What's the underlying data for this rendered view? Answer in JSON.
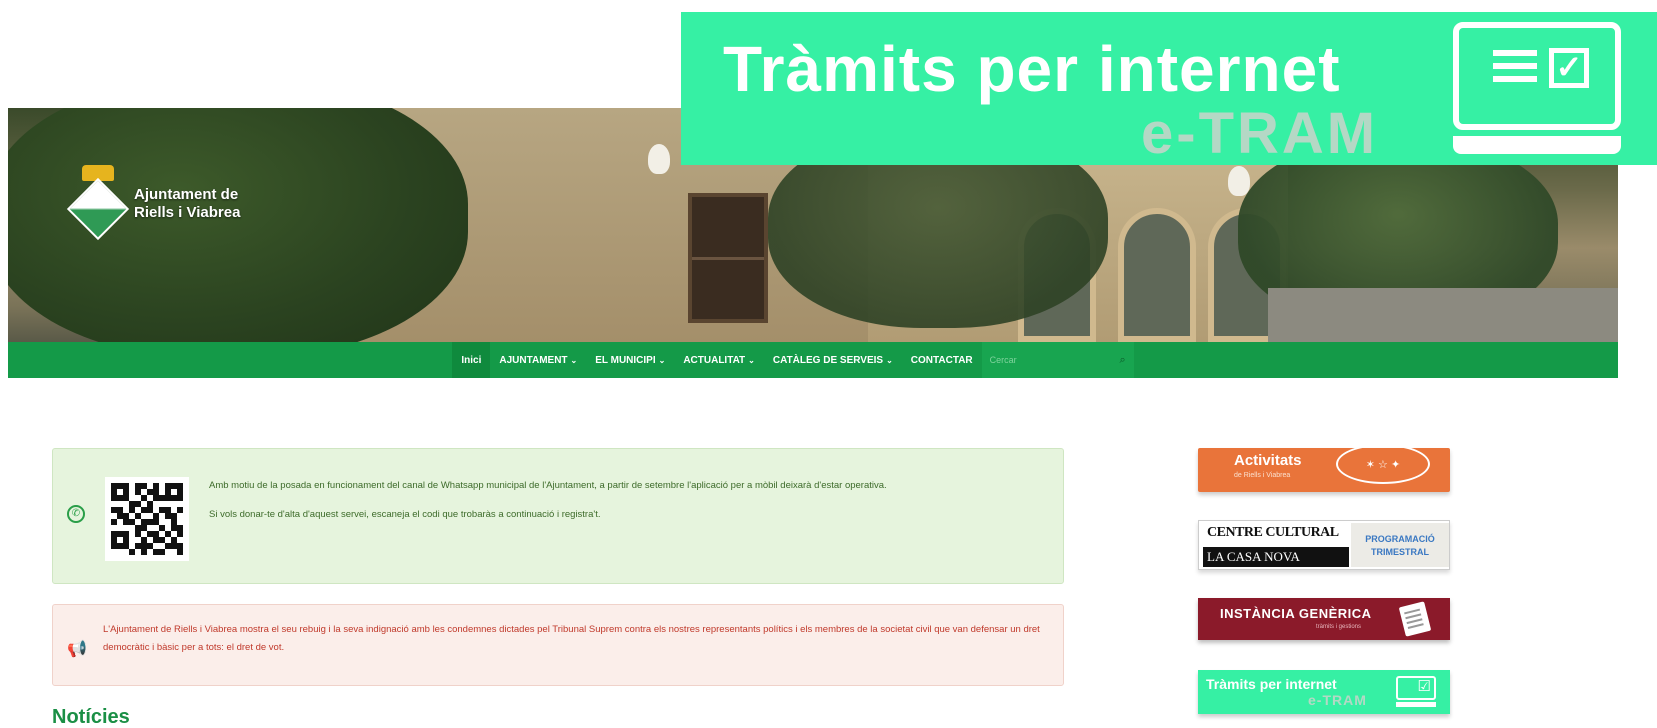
{
  "header": {
    "logo_line1": "Ajuntament de",
    "logo_line2": "Riells i Viabrea"
  },
  "etram_banner": {
    "title": "Tràmits per internet",
    "subtitle": "e-TRAM"
  },
  "nav": {
    "items": [
      {
        "label": "Inici",
        "active": true,
        "has_dropdown": false
      },
      {
        "label": "AJUNTAMENT",
        "has_dropdown": true
      },
      {
        "label": "EL MUNICIPI",
        "has_dropdown": true
      },
      {
        "label": "ACTUALITAT",
        "has_dropdown": true
      },
      {
        "label": "CATÀLEG DE SERVEIS",
        "has_dropdown": true
      },
      {
        "label": "CONTACTAR",
        "has_dropdown": false
      }
    ],
    "search_placeholder": "Cercar"
  },
  "alerts": {
    "whatsapp_p1": "Amb motiu de la posada en funcionament del canal de Whatsapp municipal de l'Ajuntament, a partir de setembre l'aplicació per a mòbil deixarà d'estar operativa.",
    "whatsapp_p2": "Si vols donar-te d'alta d'aquest servei, escaneja el codi que trobaràs a continuació i registra't.",
    "notice": "L'Ajuntament de Riells i Viabrea mostra el seu rebuig i la seva indignació amb les condemnes dictades pel Tribunal Suprem contra els nostres representants polítics i els membres de la societat civil que van defensar un dret democràtic i bàsic per a tots: el dret de vot."
  },
  "section_title": "Notícies",
  "sidebar": {
    "activitats_title": "Activitats",
    "activitats_sub": "de Riells i Viabrea",
    "casa_line1": "CENTRE CULTURAL",
    "casa_line2": "LA CASA NOVA",
    "casa_right_1": "PROGRAMACIÓ",
    "casa_right_2": "TRIMESTRAL",
    "instancia_title": "INSTÀNCIA GENÈRICA",
    "instancia_sub": "tràmits i gestions",
    "etram_title": "Tràmits per internet",
    "etram_sub": "e-TRAM"
  },
  "colors": {
    "nav_green": "#149a48",
    "etram_green": "#36f0a4",
    "alert_green_bg": "#e6f4dd",
    "alert_red_bg": "#fbeeea",
    "activitats_orange": "#e9743a",
    "instancia_maroon": "#8b1a2a"
  }
}
